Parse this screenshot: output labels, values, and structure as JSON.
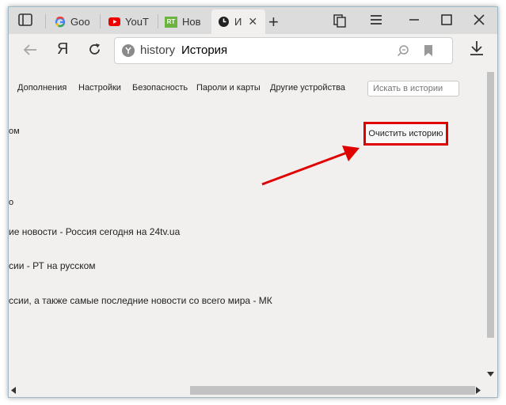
{
  "tabs": [
    {
      "label": "Goo",
      "icon": "google-icon"
    },
    {
      "label": "YouT",
      "icon": "youtube-icon"
    },
    {
      "label": "Нов",
      "icon": "rt-icon"
    },
    {
      "label": "И",
      "icon": "history-clock-icon",
      "active": true
    }
  ],
  "rt_logo_text": "RT",
  "address": {
    "protocol": "history",
    "title": "История"
  },
  "nav_items": [
    "Дополнения",
    "Настройки",
    "Безопасность",
    "Пароли и карты",
    "Другие устройства"
  ],
  "search": {
    "placeholder": "Искать в истории"
  },
  "clear_button": "Очистить историю",
  "fragments": {
    "top_left": "ом",
    "mid_left": "о"
  },
  "entries": [
    "ие новости - Россия сегодня на 24tv.ua",
    "сии - РТ на русском",
    "ссии, а также самые последние новости со всего мира - МК"
  ],
  "colors": {
    "annotation_red": "#e00000",
    "tab_bar": "#dcdcdc",
    "page_bg": "#f1f0ee"
  }
}
